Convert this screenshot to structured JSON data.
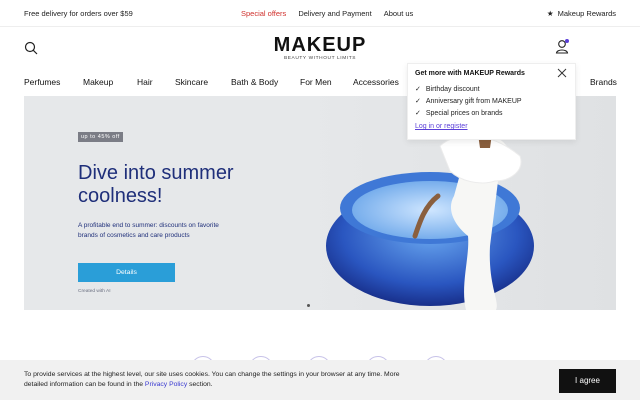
{
  "topbar": {
    "delivery": "Free delivery for orders over $59",
    "links": [
      "Special offers",
      "Delivery and Payment",
      "About us"
    ],
    "rewards": "Makeup Rewards"
  },
  "header": {
    "logo": "MAKEUP",
    "tagline": "BEAUTY WITHOUT LIMITS"
  },
  "nav": [
    "Perfumes",
    "Makeup",
    "Hair",
    "Skincare",
    "Bath & Body",
    "For Men",
    "Accessories",
    "Brands"
  ],
  "hero": {
    "badge": "up to 45% off",
    "headline": "Dive into summer coolness!",
    "subtitle": "A profitable end to summer: discounts on favorite brands of cosmetics and care products",
    "cta": "Details",
    "created": "Created with AI"
  },
  "rewards_popup": {
    "title": "Get more with MAKEUP Rewards",
    "benefits": [
      "Birthday discount",
      "Anniversary gift from MAKEUP",
      "Special prices on brands"
    ],
    "link": "Log in or register"
  },
  "cookie": {
    "text_before": "To provide services at the highest level, our site uses cookies. You can change the settings in your browser at any time. More detailed information can be found in the ",
    "policy_link": "Privacy Policy",
    "text_after": " section.",
    "agree": "I agree"
  },
  "colors": {
    "accent_red": "#d0312d",
    "headline_blue": "#1f2f7a",
    "cta_blue": "#2a9ed8",
    "link_purple": "#5a3fd8"
  }
}
